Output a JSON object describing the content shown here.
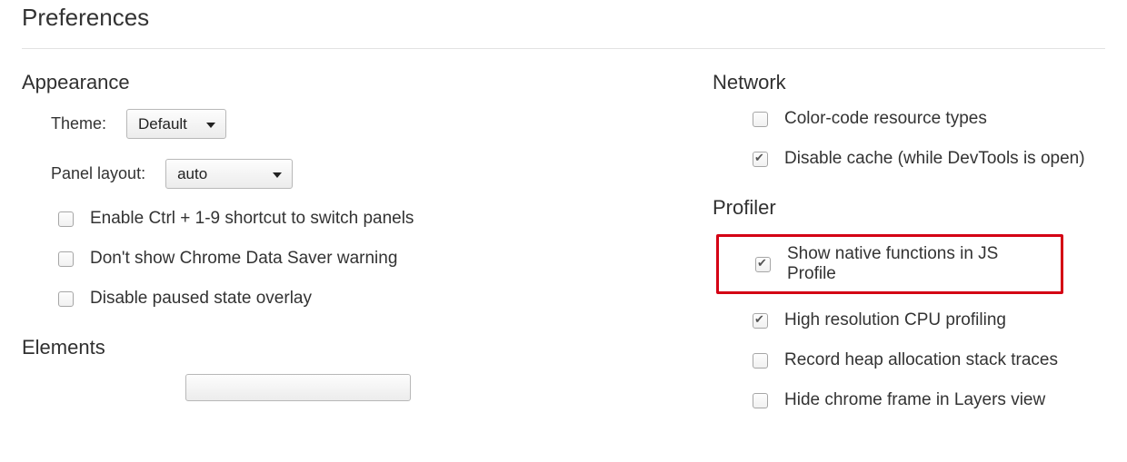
{
  "page_title": "Preferences",
  "left": {
    "appearance": {
      "title": "Appearance",
      "theme_label": "Theme:",
      "theme_value": "Default",
      "layout_label": "Panel layout:",
      "layout_value": "auto",
      "cb_shortcut": "Enable Ctrl + 1-9 shortcut to switch panels",
      "cb_shortcut_checked": false,
      "cb_datasaver": "Don't show Chrome Data Saver warning",
      "cb_datasaver_checked": false,
      "cb_paused": "Disable paused state overlay",
      "cb_paused_checked": false
    },
    "elements": {
      "title": "Elements"
    }
  },
  "right": {
    "network": {
      "title": "Network",
      "cb_colorcode": "Color-code resource types",
      "cb_colorcode_checked": false,
      "cb_disablecache": "Disable cache (while DevTools is open)",
      "cb_disablecache_checked": true
    },
    "profiler": {
      "title": "Profiler",
      "cb_native": "Show native functions in JS Profile",
      "cb_native_checked": true,
      "cb_highres": "High resolution CPU profiling",
      "cb_highres_checked": true,
      "cb_heap": "Record heap allocation stack traces",
      "cb_heap_checked": false,
      "cb_hidechrome": "Hide chrome frame in Layers view",
      "cb_hidechrome_checked": false
    }
  }
}
